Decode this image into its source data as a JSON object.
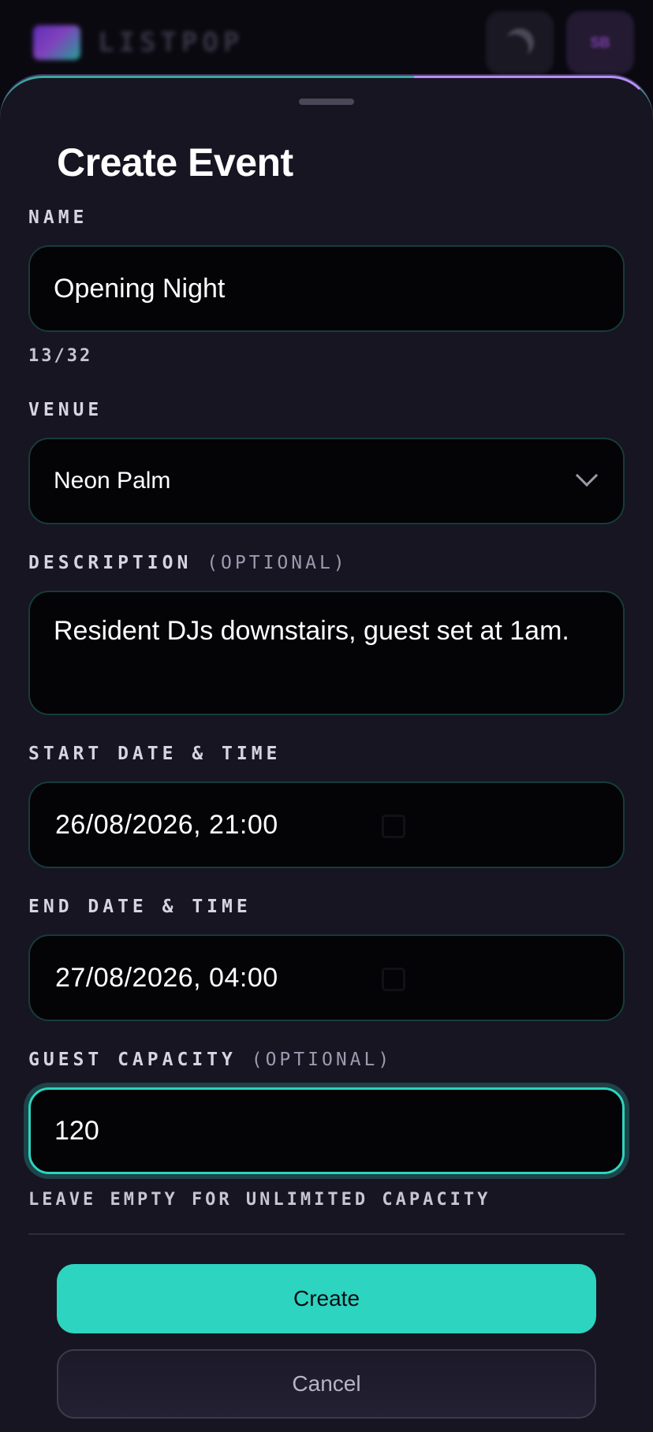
{
  "header": {
    "brand": "LISTPOP",
    "avatar_initials": "SB",
    "theme_icon": "moon-icon"
  },
  "form": {
    "title": "Create Event",
    "name": {
      "label": "NAME",
      "value": "Opening Night",
      "counter": "13/32"
    },
    "venue": {
      "label": "VENUE",
      "value": "Neon Palm",
      "icon": "chevron-down-icon"
    },
    "description": {
      "label": "DESCRIPTION",
      "optional": "(OPTIONAL)",
      "value": "Resident DJs downstairs, guest set at 1am."
    },
    "start": {
      "label": "START DATE & TIME",
      "value": "26/08/2026, 21:00",
      "icon": "calendar-icon"
    },
    "end": {
      "label": "END DATE & TIME",
      "value": "27/08/2026, 04:00",
      "icon": "calendar-icon"
    },
    "capacity": {
      "label": "GUEST CAPACITY",
      "optional": "(OPTIONAL)",
      "value": "120",
      "hint": "LEAVE EMPTY FOR UNLIMITED CAPACITY"
    }
  },
  "actions": {
    "create_label": "Create",
    "cancel_label": "Cancel"
  },
  "colors": {
    "accent": "#2dd4bf",
    "sheet_bg": "#171522",
    "field_bg": "#040306"
  }
}
